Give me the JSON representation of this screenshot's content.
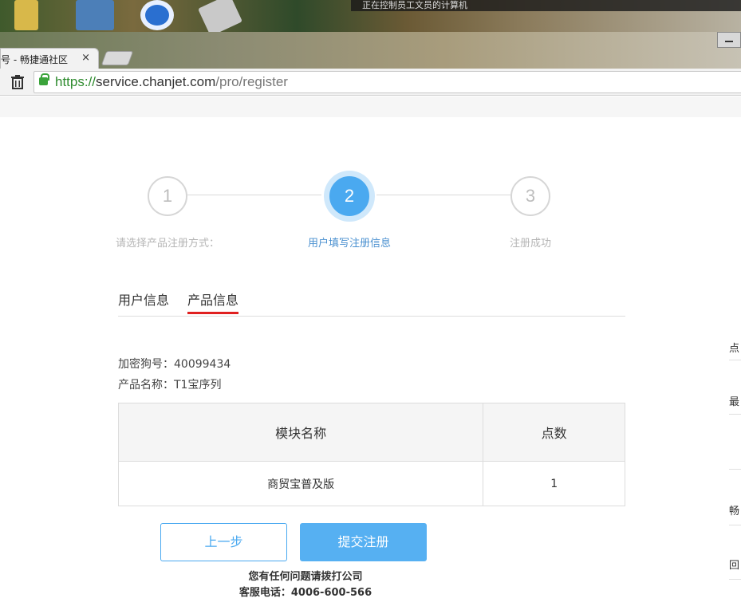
{
  "desktop": {
    "remote_notice": "正在控制员工文员的计算机"
  },
  "browser": {
    "tab_title": "号 - 畅捷通社区",
    "tab_close": "×",
    "url_scheme": "https://",
    "url_host": "service.chanjet.com",
    "url_path": "/pro/register"
  },
  "steps": [
    {
      "number": "1",
      "label": "请选择产品注册方式："
    },
    {
      "number": "2",
      "label": "用户填写注册信息"
    },
    {
      "number": "3",
      "label": "注册成功"
    }
  ],
  "tabs": {
    "user_info": "用户信息",
    "product_info": "产品信息"
  },
  "product": {
    "dongle_line": "加密狗号：40099434",
    "name_line": "产品名称：T1宝序列"
  },
  "modules_table": {
    "headers": [
      "模块名称",
      "点数"
    ],
    "rows": [
      [
        "商贸宝普及版",
        "1"
      ]
    ]
  },
  "buttons": {
    "prev": "上一步",
    "submit": "提交注册"
  },
  "help": {
    "line1": "您有任何问题请拨打公司",
    "line2": "客服电话：4006-600-566"
  },
  "right_edge": [
    "点",
    "最",
    "畅",
    "回"
  ],
  "colors": {
    "accent": "#4aa9f0",
    "active_underline": "#e02020",
    "lock_green": "#3aa33a"
  }
}
